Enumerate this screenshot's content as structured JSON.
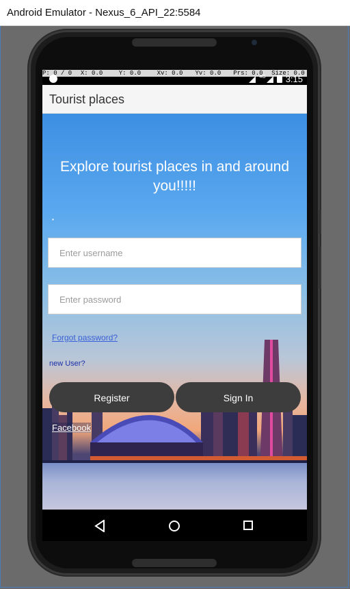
{
  "window": {
    "title": "Android Emulator - Nexus_6_API_22:5584"
  },
  "pointer_info": [
    "P: 0 / 0",
    "X: 0.0",
    "Y: 0.0",
    "Xv: 0.0",
    "Yv: 0.0",
    "Prs: 0.0",
    "Size: 0.0"
  ],
  "status": {
    "time": "3:15",
    "network": "4G"
  },
  "app": {
    "title": "Tourist places"
  },
  "main": {
    "headline": "Explore tourist places in and around you!!!!!",
    "username_placeholder": "Enter username",
    "password_placeholder": "Enter password",
    "forgot_label": "Forgot password?",
    "new_user_label": "new User?",
    "register_label": "Register",
    "signin_label": "Sign In",
    "facebook_label": "Facebook"
  },
  "nav": {
    "icons": [
      "back-icon",
      "home-icon",
      "recents-icon"
    ]
  }
}
